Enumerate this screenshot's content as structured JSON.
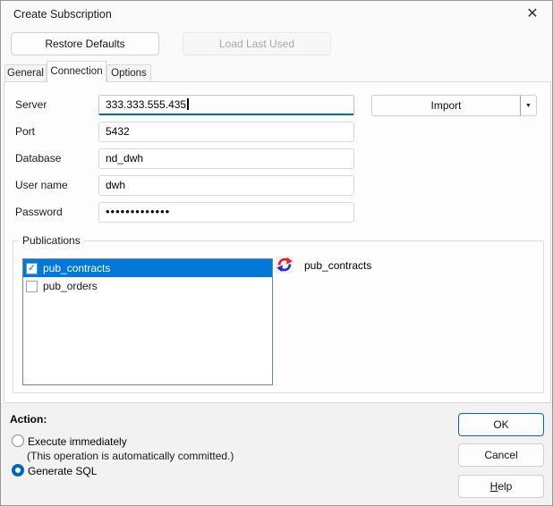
{
  "window": {
    "title": "Create Subscription",
    "close_icon": "✕"
  },
  "header": {
    "restore_defaults": "Restore Defaults",
    "load_last_used": "Load Last Used"
  },
  "tabs": {
    "general": "General",
    "connection": "Connection",
    "options": "Options"
  },
  "form": {
    "fields": [
      {
        "label": "Server",
        "value": "333.333.555.435",
        "focused": true
      },
      {
        "label": "Port",
        "value": "5432"
      },
      {
        "label": "Database",
        "value": "nd_dwh"
      },
      {
        "label": "User name",
        "value": "dwh"
      },
      {
        "label": "Password",
        "value": "•••••••••••••",
        "masked": true
      }
    ],
    "import": {
      "label": "Import",
      "dropdown_icon": "▼"
    }
  },
  "publications": {
    "label": "Publications",
    "check_icon": "✓",
    "items": [
      {
        "name": "pub_contracts",
        "checked": true,
        "selected": true
      },
      {
        "name": "pub_orders",
        "checked": false,
        "selected": false
      }
    ],
    "selected_name": "pub_contracts"
  },
  "action": {
    "title": "Action:",
    "execute_label": "Execute immediately",
    "execute_note": "(This operation is automatically committed.)",
    "execute_selected": false,
    "generate_label": "Generate SQL",
    "generate_selected": true
  },
  "footer_buttons": {
    "ok": "OK",
    "cancel": "Cancel",
    "help_accel": "H",
    "help_rest": "elp"
  },
  "colors": {
    "accent": "#0067c0",
    "selection_blue": "#0078d7",
    "refresh_red": "#df2424",
    "refresh_blue": "#2430c4"
  }
}
